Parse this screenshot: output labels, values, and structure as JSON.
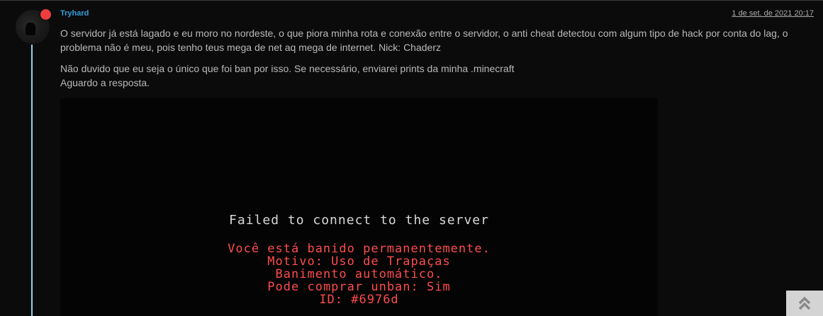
{
  "post": {
    "author": "Tryhard",
    "timestamp": "1 de set. de 2021 20:17",
    "paragraph1": "O servidor já está lagado e eu moro no nordeste, o que piora minha rota e conexão entre o servidor, o anti cheat detectou com algum tipo de hack por conta do lag, o problema não é meu, pois tenho teus mega de net aq mega de internet. Nick: Chaderz",
    "paragraph2_line1": "Não duvido que eu seja o único que foi ban por isso. Se necessário, enviarei prints da minha .minecraft",
    "paragraph2_line2": "Aguardo a resposta."
  },
  "attachment": {
    "title": "Failed to connect to the server",
    "reason_lines": [
      "Você está banido permanentemente.",
      "Motivo: Uso de Trapaças",
      "Banimento automático.",
      "Pode comprar unban: Sim",
      "ID: #6976d"
    ]
  },
  "icons": {
    "avatar": "user-avatar",
    "status": "online-status-dot",
    "scroll": "double-chevron-up-icon"
  },
  "colors": {
    "author_link": "#2f9fe0",
    "thread_line": "#8fd3ee",
    "status_dot": "#ee3d3d",
    "ban_text": "#ff4c4c"
  }
}
